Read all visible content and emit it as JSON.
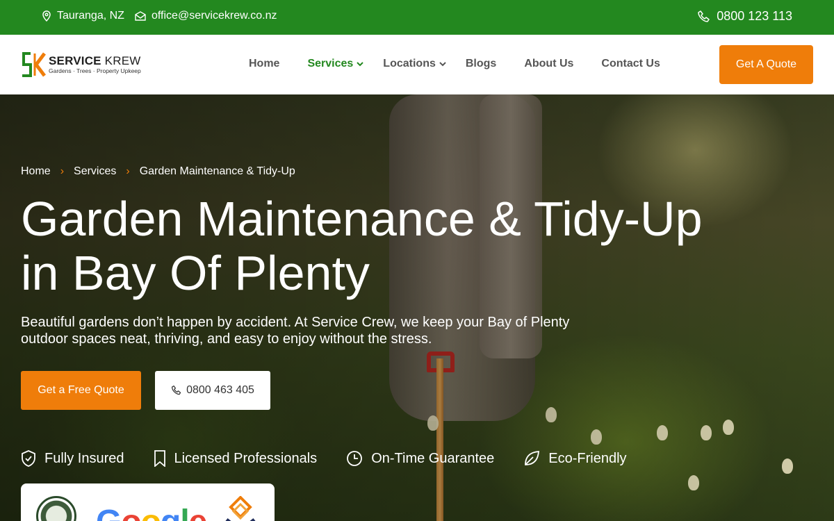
{
  "topbar": {
    "location": "Tauranga, NZ",
    "email": "office@servicekrew.co.nz",
    "phone": "0800 123 113"
  },
  "logo": {
    "name_bold": "SERVICE",
    "name_light": "KREW",
    "tagline": "Gardens · Trees · Property Upkeep"
  },
  "nav": {
    "items": [
      {
        "label": "Home"
      },
      {
        "label": "Services"
      },
      {
        "label": "Locations"
      },
      {
        "label": "Blogs"
      },
      {
        "label": "About Us"
      },
      {
        "label": "Contact Us"
      }
    ],
    "cta": "Get A Quote"
  },
  "hero": {
    "breadcrumb": [
      "Home",
      "Services",
      "Garden Maintenance & Tidy-Up"
    ],
    "title_line1": "Garden Maintenance & Tidy-Up",
    "title_line2": "in Bay Of Plenty",
    "description": "Beautiful gardens don’t happen by accident. At Service Crew, we keep your Bay of Plenty outdoor spaces neat, thriving, and easy to enjoy without the stress.",
    "primary_button": "Get a Free Quote",
    "phone_button": "0800 463 405",
    "features": [
      "Fully Insured",
      "Licensed Professionals",
      "On-Time Guarantee",
      "Eco-Friendly"
    ]
  },
  "badges": {
    "google_text": "Google"
  },
  "colors": {
    "brand_green": "#23881f",
    "accent_orange": "#ef7d0a"
  }
}
